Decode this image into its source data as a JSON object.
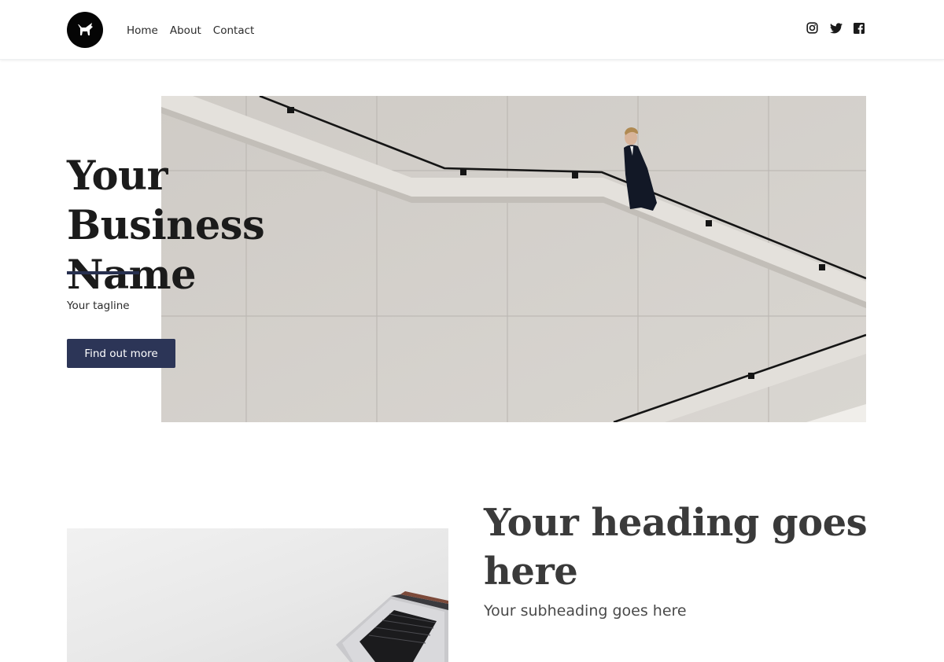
{
  "nav": {
    "items": [
      {
        "label": "Home"
      },
      {
        "label": "About"
      },
      {
        "label": "Contact"
      }
    ]
  },
  "social": {
    "icons": [
      "instagram-icon",
      "twitter-icon",
      "facebook-icon"
    ]
  },
  "hero": {
    "title": "Your Business Name",
    "tagline": "Your tagline",
    "button_label": "Find out more",
    "accent_color": "#27304f",
    "button_color": "#2c3557"
  },
  "section": {
    "heading": "Your heading goes here",
    "subheading": "Your subheading goes here"
  }
}
